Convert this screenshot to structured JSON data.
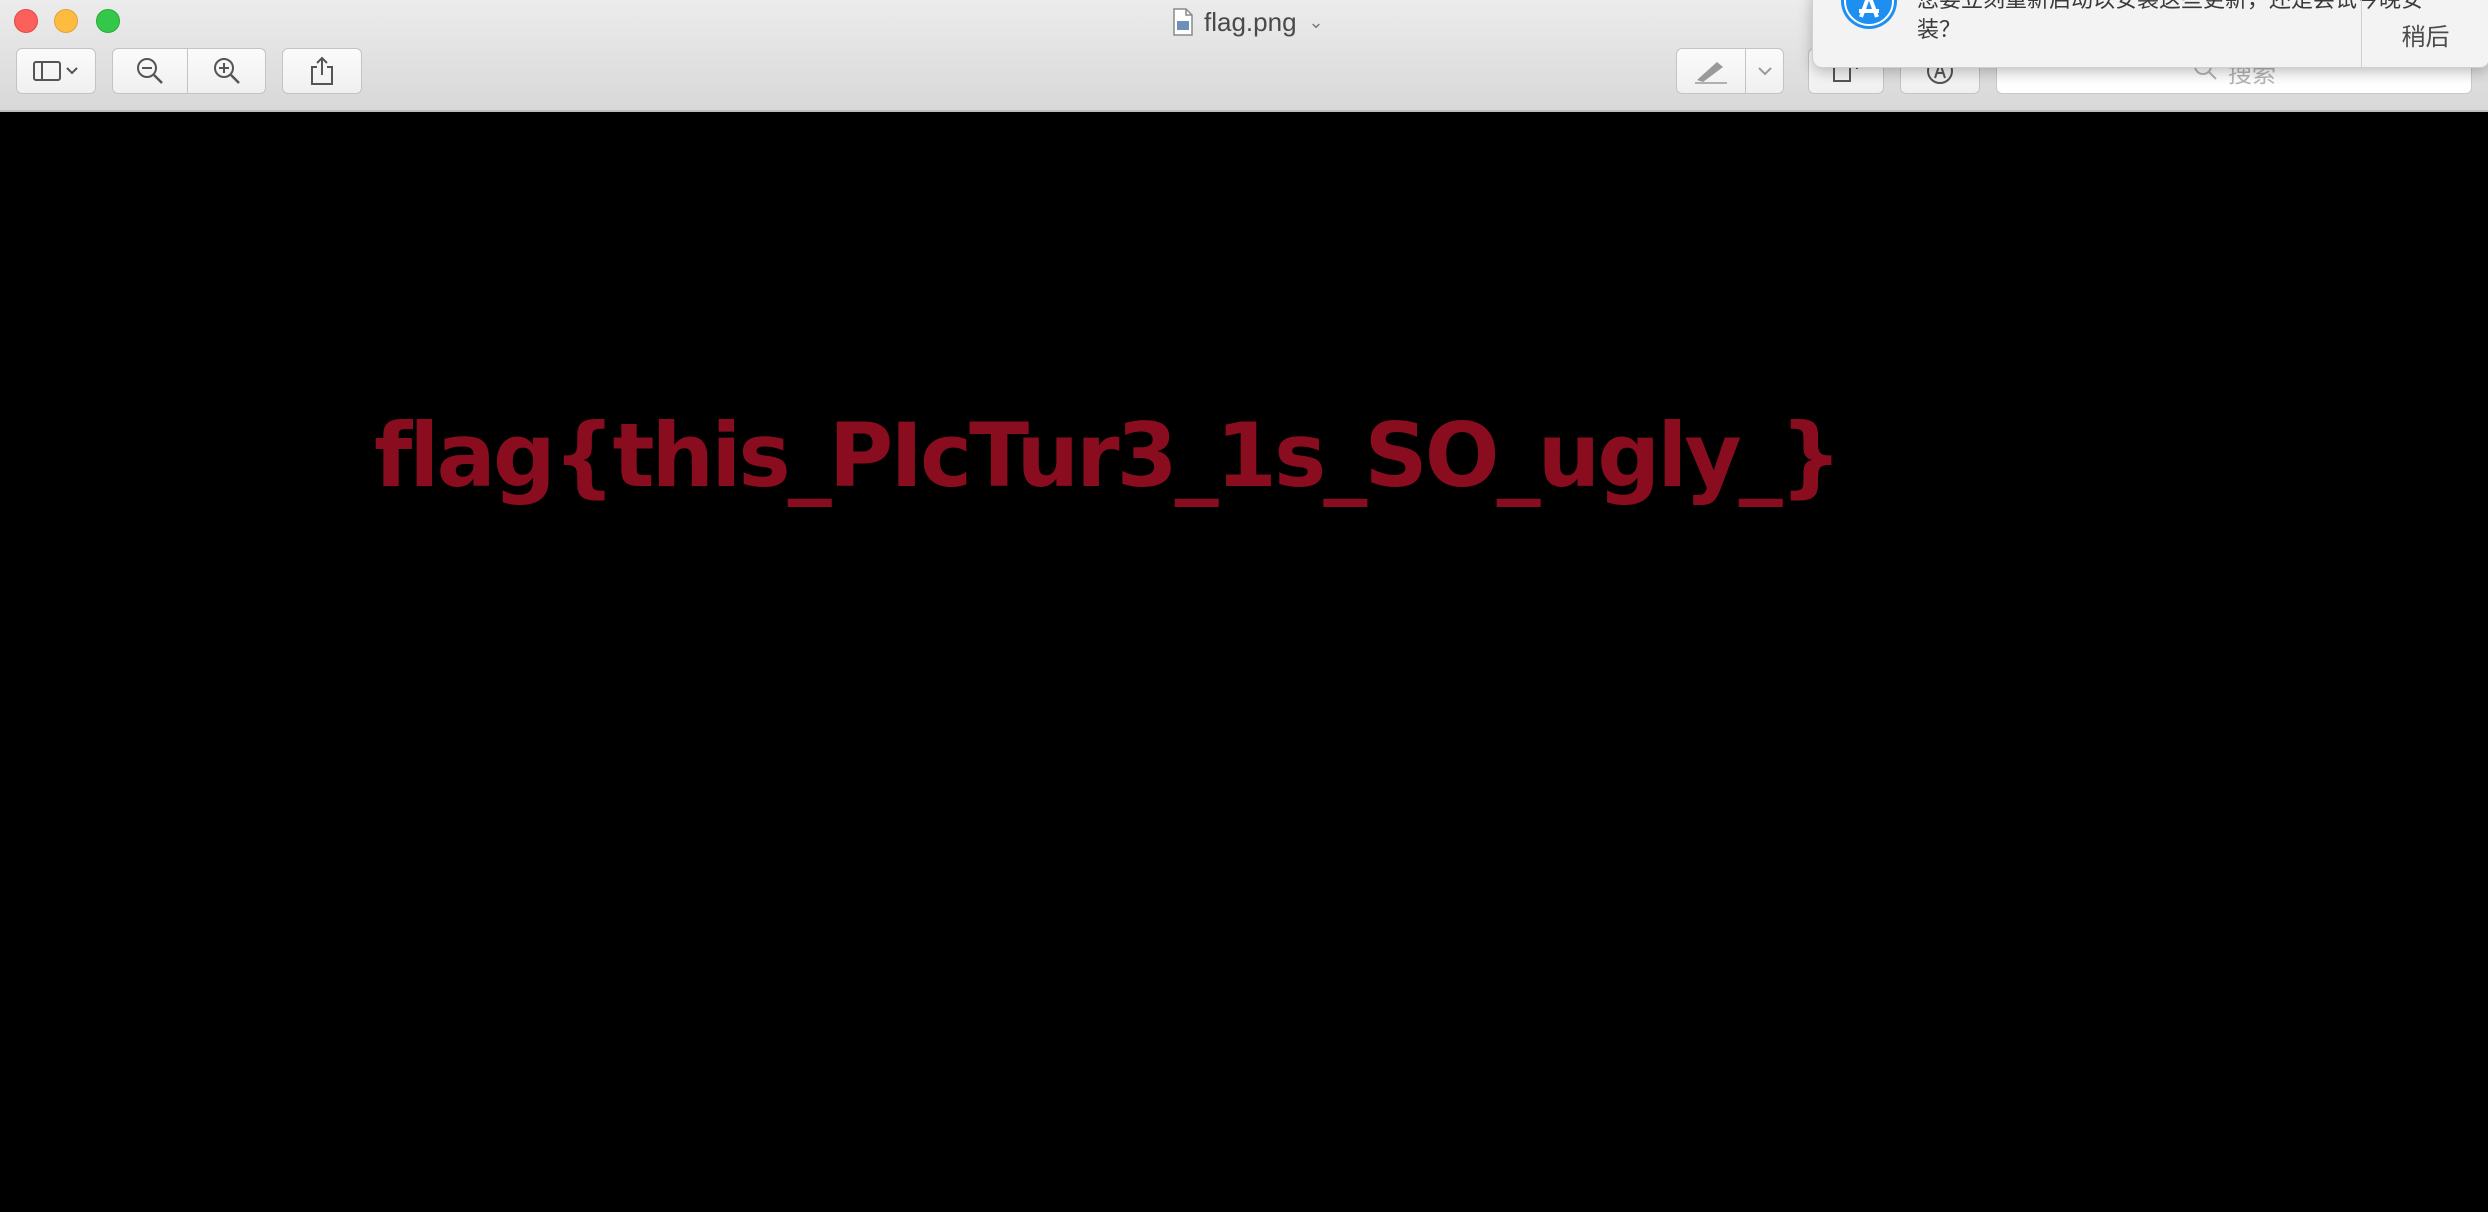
{
  "window": {
    "title": "flag.png",
    "title_chevron": "⌄"
  },
  "toolbar": {
    "sidebar_toggle_icon": "sidebar-icon",
    "zoom_out_icon": "zoom-out-icon",
    "zoom_in_icon": "zoom-in-icon",
    "share_icon": "share-icon",
    "markup_icon": "pen-icon",
    "rotate_icon": "rotate-icon",
    "annotate_icon": "markup-circle-icon",
    "search_placeholder": "搜索"
  },
  "notification": {
    "message": "您要立刻重新启动以安装这些更新，还是尝试今晚安装？",
    "later_label": "稍后",
    "app_icon": "app-store-icon"
  },
  "image": {
    "text": "flag{this_PIcTur3_1s_SO_ugly_}",
    "text_color": "#8a0d1f",
    "background_color": "#000000"
  }
}
